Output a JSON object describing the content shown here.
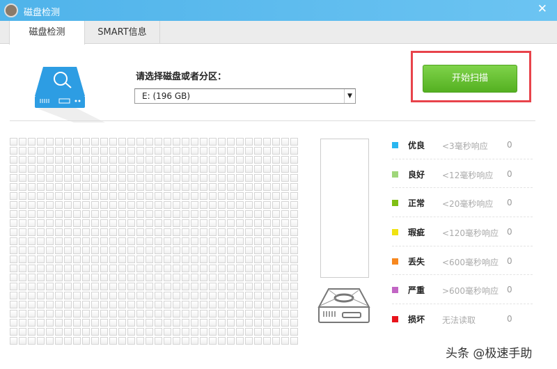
{
  "window": {
    "title": "磁盘检测",
    "close_icon": "close-icon"
  },
  "tabs": [
    {
      "label": "磁盘检测",
      "active": true
    },
    {
      "label": "SMART信息",
      "active": false
    }
  ],
  "disk_select": {
    "label": "请选择磁盘或者分区：",
    "value": "E:  (196 GB)"
  },
  "scan_button": "开始扫描",
  "grid": {
    "columns": 32,
    "rows": 23
  },
  "legend": [
    {
      "name": "优良",
      "desc": "<3毫秒响应",
      "count": "0",
      "color": "#29b6f0"
    },
    {
      "name": "良好",
      "desc": "<12毫秒响应",
      "count": "0",
      "color": "#9fd67a"
    },
    {
      "name": "正常",
      "desc": "<20毫秒响应",
      "count": "0",
      "color": "#7fbf14"
    },
    {
      "name": "瑕疵",
      "desc": "<120毫秒响应",
      "count": "0",
      "color": "#f0e312"
    },
    {
      "name": "丢失",
      "desc": "<600毫秒响应",
      "count": "0",
      "color": "#f7881f"
    },
    {
      "name": "严重",
      "desc": ">600毫秒响应",
      "count": "0",
      "color": "#c266c4"
    },
    {
      "name": "损坏",
      "desc": "无法读取",
      "count": "0",
      "color": "#e8141c"
    }
  ],
  "watermark": "头条 @极速手助"
}
